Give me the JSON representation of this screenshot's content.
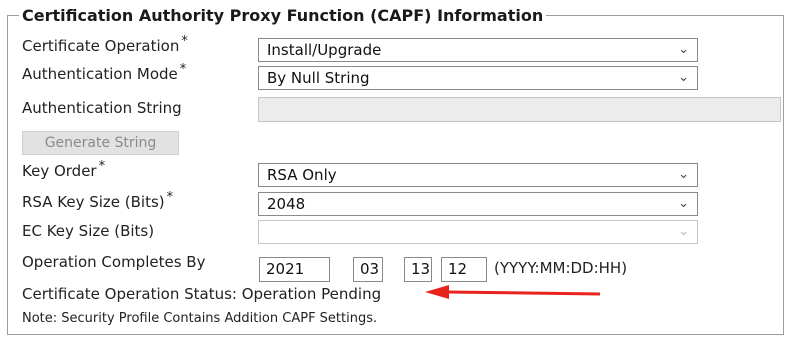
{
  "section": {
    "title": "Certification Authority Proxy Function (CAPF) Information"
  },
  "fields": {
    "certificate_operation": {
      "label": "Certificate Operation",
      "required": "*",
      "value": "Install/Upgrade"
    },
    "authentication_mode": {
      "label": "Authentication Mode",
      "required": "*",
      "value": "By Null String"
    },
    "authentication_string": {
      "label": "Authentication String",
      "value": ""
    },
    "generate_button": {
      "label": "Generate String"
    },
    "key_order": {
      "label": "Key Order",
      "required": "*",
      "value": "RSA Only"
    },
    "rsa_key_size": {
      "label": "RSA Key Size (Bits)",
      "required": "*",
      "value": "2048"
    },
    "ec_key_size": {
      "label": "EC Key Size (Bits)",
      "value": ""
    },
    "operation_completes_by": {
      "label": "Operation Completes By",
      "year": "2021",
      "month": "03",
      "day": "13",
      "hour": "12",
      "format_hint": "(YYYY:MM:DD:HH)"
    }
  },
  "status_text": "Certificate Operation Status: Operation Pending",
  "note_text": "Note: Security Profile Contains Addition CAPF Settings.",
  "icons": {
    "dropdown": "chevron-down-icon",
    "pointer": "red-arrow-icon"
  },
  "colors": {
    "arrow": "#e8231c",
    "border": "#8a8a8a",
    "disabled_bg": "#ececec"
  }
}
